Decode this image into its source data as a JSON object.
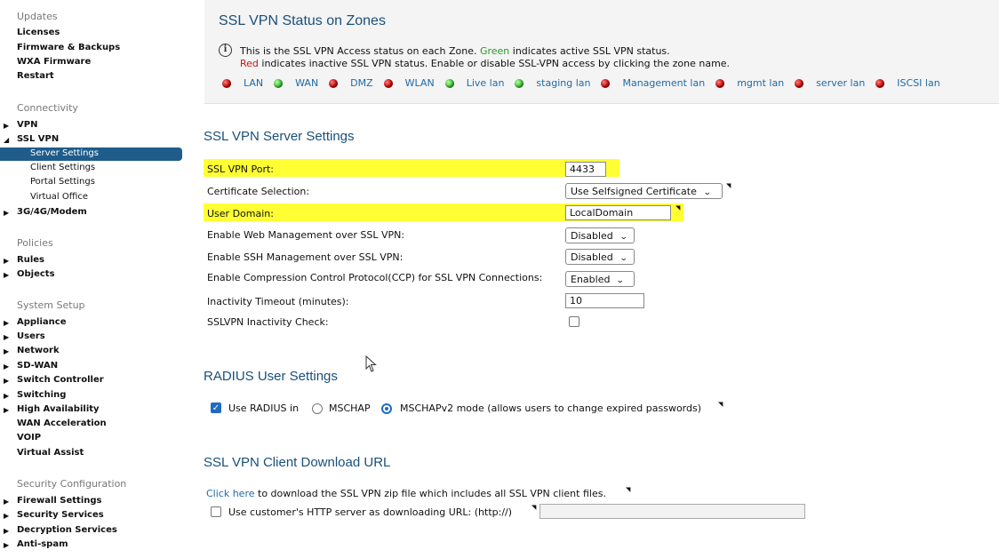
{
  "sidebar": {
    "updates": {
      "heading": "Updates",
      "items": [
        "Licenses",
        "Firmware & Backups",
        "WXA Firmware",
        "Restart"
      ]
    },
    "connectivity": {
      "heading": "Connectivity",
      "vpn": "VPN",
      "ssl_vpn": "SSL VPN",
      "ssl_vpn_children": [
        "Server Settings",
        "Client Settings",
        "Portal Settings",
        "Virtual Office"
      ],
      "modem": "3G/4G/Modem"
    },
    "policies": {
      "heading": "Policies",
      "items": [
        "Rules",
        "Objects"
      ]
    },
    "system_setup": {
      "heading": "System Setup",
      "items": [
        "Appliance",
        "Users",
        "Network",
        "SD-WAN",
        "Switch Controller",
        "Switching",
        "High Availability",
        "WAN Acceleration",
        "VOIP",
        "Virtual Assist"
      ]
    },
    "security_configuration": {
      "heading": "Security Configuration",
      "items": [
        "Firewall Settings",
        "Security Services",
        "Decryption Services",
        "Anti-spam"
      ]
    }
  },
  "zone_status": {
    "title": "SSL VPN Status on Zones",
    "info_a": "This is the SSL VPN Access status on each Zone.",
    "green_word": "Green",
    "info_b": "indicates active SSL VPN status.",
    "red_word": "Red",
    "info_c": "indicates inactive SSL VPN status. Enable or disable SSL-VPN access by clicking the zone name.",
    "zones": [
      {
        "name": "LAN",
        "status": "red"
      },
      {
        "name": "WAN",
        "status": "green"
      },
      {
        "name": "DMZ",
        "status": "red"
      },
      {
        "name": "WLAN",
        "status": "red"
      },
      {
        "name": "Live lan",
        "status": "green"
      },
      {
        "name": "staging lan",
        "status": "green"
      },
      {
        "name": "Management lan",
        "status": "red"
      },
      {
        "name": "mgmt lan",
        "status": "red"
      },
      {
        "name": "server lan",
        "status": "red"
      },
      {
        "name": "ISCSI lan",
        "status": "red"
      }
    ]
  },
  "server_settings": {
    "title": "SSL VPN Server Settings",
    "port_label": "SSL VPN Port:",
    "port_value": "4433",
    "cert_label": "Certificate Selection:",
    "cert_value": "Use Selfsigned Certificate",
    "domain_label": "User Domain:",
    "domain_value": "LocalDomain",
    "web_mgmt_label": "Enable Web Management over SSL VPN:",
    "web_mgmt_value": "Disabled",
    "ssh_mgmt_label": "Enable SSH Management over SSL VPN:",
    "ssh_mgmt_value": "Disabled",
    "ccp_label": "Enable Compression Control Protocol(CCP) for SSL VPN Connections:",
    "ccp_value": "Enabled",
    "timeout_label": "Inactivity Timeout (minutes):",
    "timeout_value": "10",
    "inactivity_check_label": "SSLVPN Inactivity Check:"
  },
  "radius": {
    "title": "RADIUS User Settings",
    "use_radius_label": "Use RADIUS in",
    "mschap_label": "MSCHAP",
    "mschapv2_label": "MSCHAPv2 mode (allows users to change expired passwords)"
  },
  "download": {
    "title": "SSL VPN Client Download URL",
    "link_text": "Click here",
    "link_rest": "to download the SSL VPN zip file which includes all SSL VPN client files.",
    "custom_server_label": "Use customer's HTTP server as downloading URL: (http://)",
    "custom_server_value": ""
  },
  "colors": {
    "accent": "#1a4f7a",
    "selected_nav": "#1f5c8b",
    "highlight": "#ffff33",
    "link": "#1f6aa5"
  }
}
